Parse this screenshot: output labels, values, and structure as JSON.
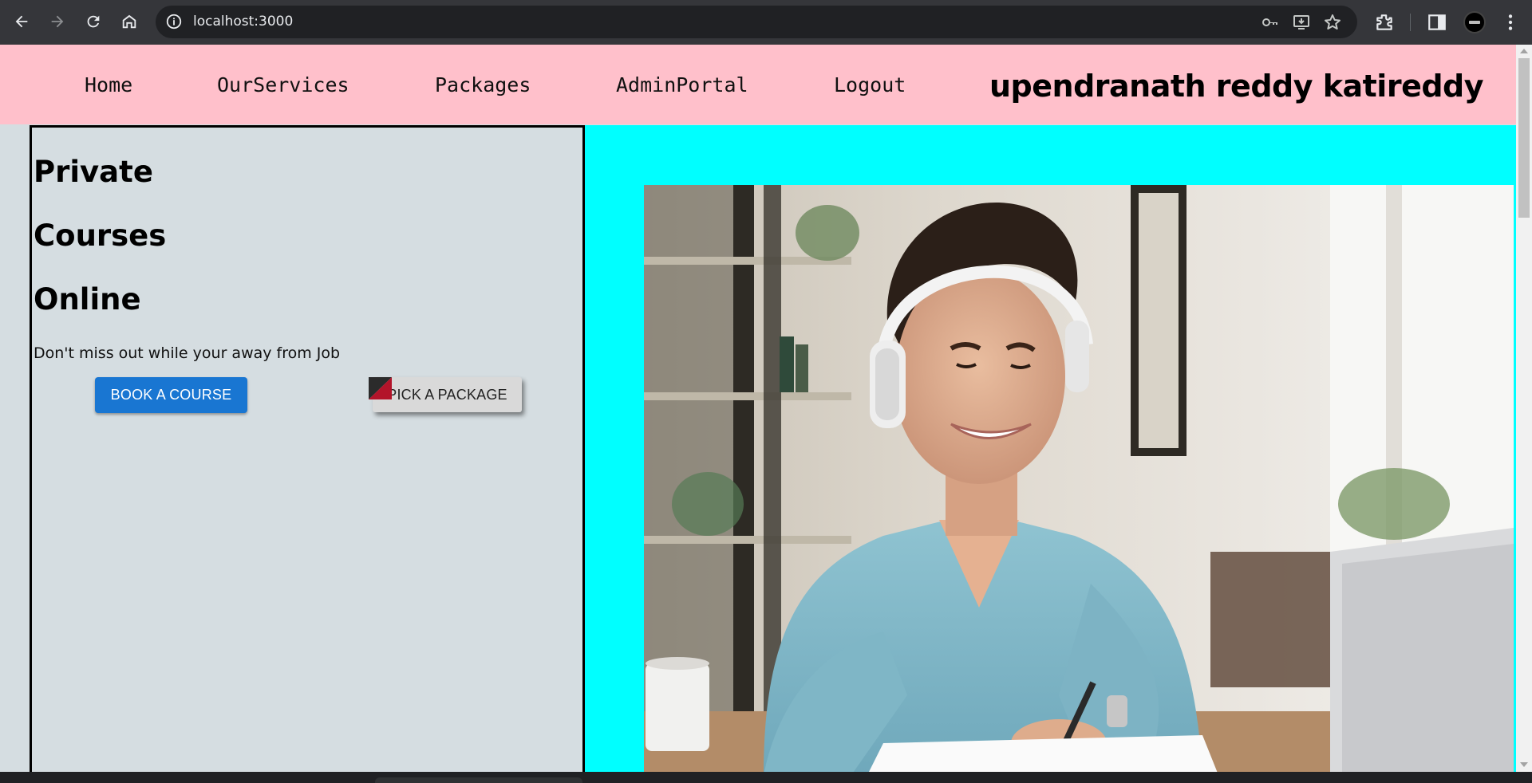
{
  "browser": {
    "url": "localhost:3000",
    "icons": [
      "back-icon",
      "forward-icon",
      "reload-icon",
      "home-icon",
      "info-icon",
      "key-icon",
      "install-icon",
      "star-icon",
      "extensions-icon",
      "sidepanel-icon",
      "avatar",
      "menu-icon"
    ]
  },
  "navbar": {
    "links": [
      {
        "label": "Home"
      },
      {
        "label": "OurServices"
      },
      {
        "label": "Packages"
      },
      {
        "label": "AdminPortal"
      },
      {
        "label": "Logout"
      }
    ],
    "user_name": "upendranath reddy katireddy",
    "background": "#ffc0cb"
  },
  "hero": {
    "headings": [
      "Private",
      "Courses",
      "Online"
    ],
    "tagline": "Don't miss out while your away from Job",
    "book_button": "BOOK A COURSE",
    "pick_button": "PICK A PACKAGE",
    "book_button_color": "#1976d2",
    "right_panel_color": "#00ffff",
    "image_alt": "student-with-headphones-photo"
  }
}
